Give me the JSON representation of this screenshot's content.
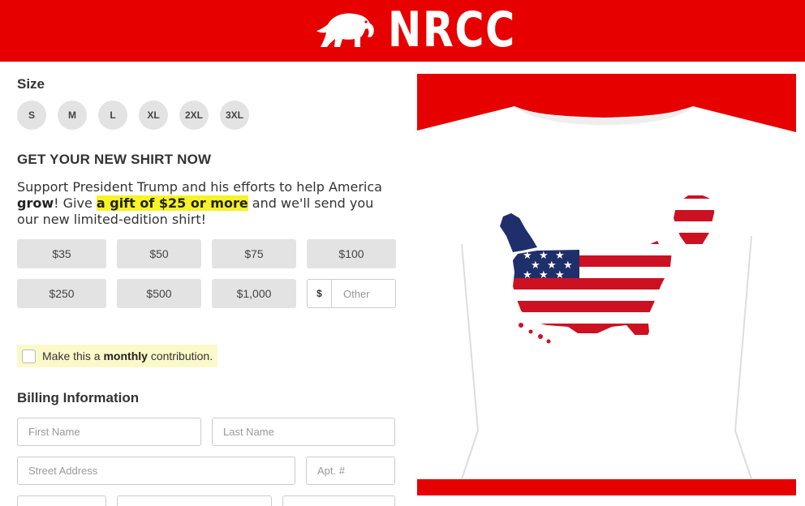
{
  "header": {
    "logo_text": "NRCC",
    "background_color": "#e60000"
  },
  "size_selector": {
    "label": "Size",
    "options": [
      "S",
      "M",
      "L",
      "XL",
      "2XL",
      "3XL"
    ]
  },
  "promo": {
    "heading": "GET YOUR NEW SHIRT NOW",
    "text_1": "Support President Trump and his efforts to help America ",
    "text_bold": "grow",
    "text_2": "! Give ",
    "highlight": "a gift of $25 or more",
    "text_3": " and we'll send you our new limited-edition shirt!",
    "highlight_color": "#f7f325"
  },
  "amounts": {
    "options": [
      "$35",
      "$50",
      "$75",
      "$100",
      "$250",
      "$500",
      "$1,000"
    ],
    "other_currency": "$",
    "other_placeholder": "Other"
  },
  "monthly": {
    "text_1": "Make this a ",
    "text_bold": "monthly",
    "text_2": " contribution.",
    "checked": false
  },
  "billing": {
    "heading": "Billing Information",
    "first_name_placeholder": "First Name",
    "last_name_placeholder": "Last Name",
    "street_placeholder": "Street Address",
    "apt_placeholder": "Apt. #"
  },
  "product_image": {
    "icon": "us-flag-map-tshirt-image"
  }
}
